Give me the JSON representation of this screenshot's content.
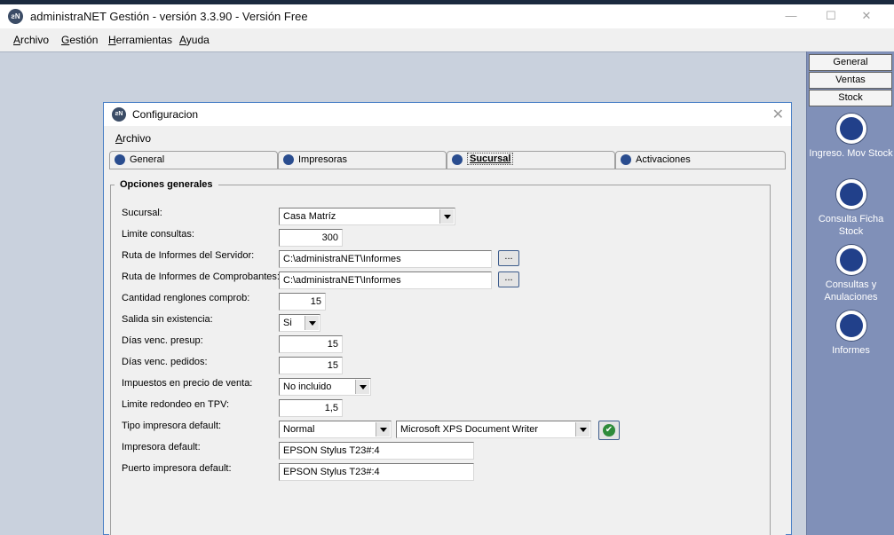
{
  "app": {
    "title": "administraNET Gestión - versión 3.3.90 - Versión Free",
    "logo": "ƨN"
  },
  "window_controls": {
    "minimize": "—",
    "maximize": "☐",
    "close": "✕"
  },
  "menu": [
    "Archivo",
    "Gestión",
    "Herramientas",
    "Ayuda"
  ],
  "sidebar": {
    "tabs": [
      "General",
      "Ventas",
      "Stock"
    ],
    "buttons": [
      {
        "label": "Ingreso. Mov Stock",
        "icon": "document-icon"
      },
      {
        "label": "Consulta Ficha Stock",
        "icon": "magnifier-icon"
      },
      {
        "label": "Consultas y Anulaciones",
        "icon": "magnifier-icon"
      },
      {
        "label": "Informes",
        "icon": "report-icon"
      }
    ]
  },
  "dialog": {
    "title": "Configuracion",
    "menu": "Archivo",
    "tabs": [
      {
        "label": "General",
        "icon": "pencil-icon"
      },
      {
        "label": "Impresoras",
        "icon": "printer-icon"
      },
      {
        "label": "Sucursal",
        "icon": "building-icon",
        "active": true
      },
      {
        "label": "Activaciones",
        "icon": "checkbox-icon"
      }
    ],
    "group_title": "Opciones generales",
    "fields": {
      "sucursal": {
        "label": "Sucursal:",
        "value": "Casa Matríz"
      },
      "limite_consultas": {
        "label": "Limite consultas:",
        "value": "300"
      },
      "ruta_servidor": {
        "label": "Ruta de Informes del Servidor:",
        "value": "C:\\administraNET\\Informes"
      },
      "ruta_comprobantes": {
        "label": "Ruta de Informes de Comprobantes:",
        "value": "C:\\administraNET\\Informes"
      },
      "cantidad_renglones": {
        "label": "Cantidad renglones comprob:",
        "value": "15"
      },
      "salida_sin_existencia": {
        "label": "Salida sin existencia:",
        "value": "Si"
      },
      "dias_presup": {
        "label": "Días venc. presup:",
        "value": "15"
      },
      "dias_pedidos": {
        "label": "Días venc. pedidos:",
        "value": "15"
      },
      "impuestos": {
        "label": "Impuestos en precio de venta:",
        "value": "No incluido"
      },
      "redondeo": {
        "label": "Limite redondeo en TPV:",
        "value": "1,5"
      },
      "tipo_impresora": {
        "label": "Tipo impresora default:",
        "value": "Normal",
        "printer": "Microsoft XPS Document Writer"
      },
      "impresora_default": {
        "label": "Impresora default:",
        "value": "EPSON Stylus T23#:4"
      },
      "puerto_impresora": {
        "label": "Puerto impresora default:",
        "value": "EPSON Stylus T23#:4"
      }
    },
    "browse_label": "...",
    "ok_icon": "✔"
  }
}
